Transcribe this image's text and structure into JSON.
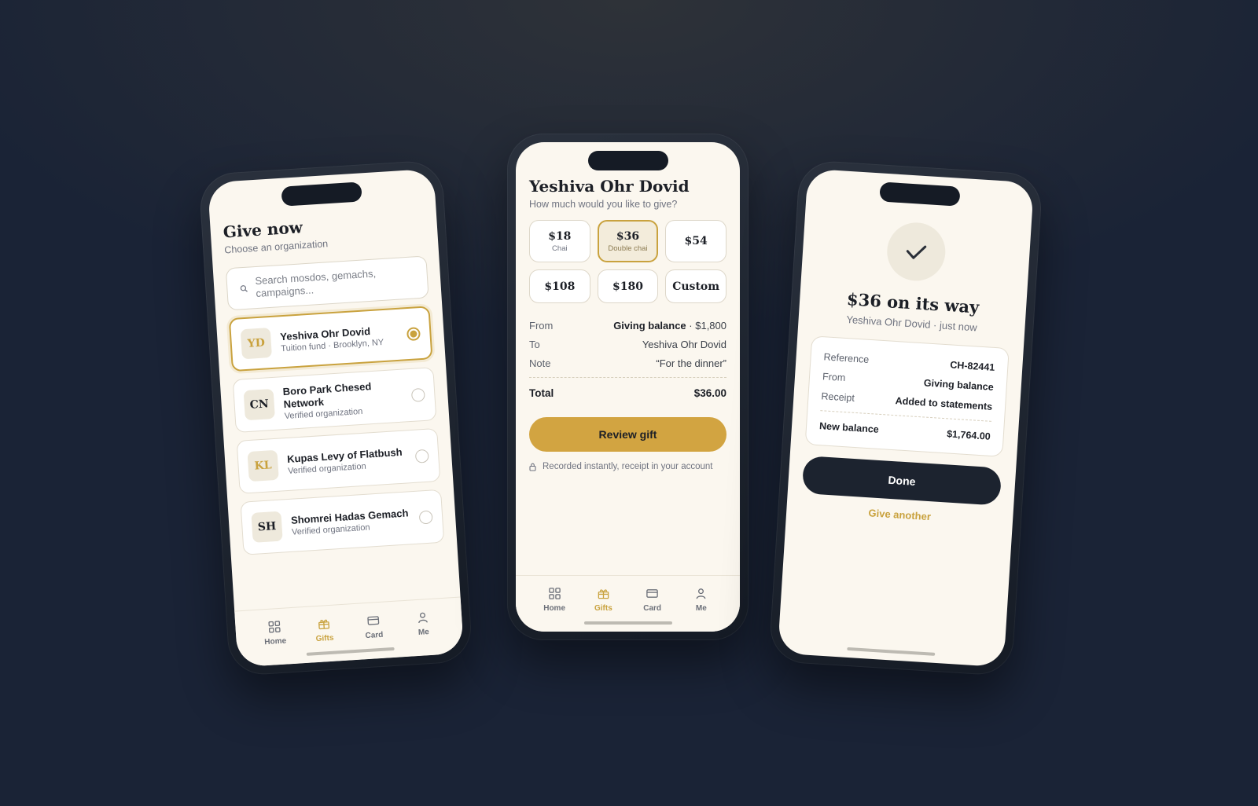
{
  "colors": {
    "accent": "#c9a23e",
    "screen_bg": "#fbf7ef",
    "dark": "#1c232f"
  },
  "tabs": [
    {
      "label": "Home",
      "icon": "grid-icon"
    },
    {
      "label": "Gifts",
      "icon": "gift-icon"
    },
    {
      "label": "Card",
      "icon": "card-icon"
    },
    {
      "label": "Me",
      "icon": "person-icon"
    }
  ],
  "active_tab": "Gifts",
  "choose": {
    "title": "Give now",
    "subtitle": "Choose an organization",
    "search_placeholder": "Search mosdos, gemachs, campaigns...",
    "orgs": [
      {
        "initials": "YD",
        "name": "Yeshiva Ohr Dovid",
        "meta": "Tuition fund · Brooklyn, NY",
        "selected": true
      },
      {
        "initials": "CN",
        "name": "Boro Park Chesed Network",
        "meta": "Verified organization",
        "selected": false
      },
      {
        "initials": "KL",
        "name": "Kupas Levy of Flatbush",
        "meta": "Verified organization",
        "selected": false
      },
      {
        "initials": "SH",
        "name": "Shomrei Hadas Gemach",
        "meta": "Verified organization",
        "selected": false
      }
    ]
  },
  "amount": {
    "title": "Yeshiva Ohr Dovid",
    "subtitle": "How much would you like to give?",
    "options": [
      {
        "value": "$18",
        "sub": "Chai"
      },
      {
        "value": "$36",
        "sub": "Double chai"
      },
      {
        "value": "$54"
      },
      {
        "value": "$108"
      },
      {
        "value": "$180"
      },
      {
        "value": "Custom"
      }
    ],
    "selected": "$36",
    "from_label": "From",
    "from_source": "Giving balance",
    "from_amount": "· $1,800",
    "to_label": "To",
    "to_value": "Yeshiva Ohr Dovid",
    "note_label": "Note",
    "note_value": "“For the dinner”",
    "total_label": "Total",
    "total_value": "$36.00",
    "review_button": "Review gift",
    "footnote": "Recorded instantly, receipt in your account"
  },
  "success": {
    "title": "$36 on its way",
    "subtitle": "Yeshiva Ohr Dovid · just now",
    "reference_label": "Reference",
    "reference_value": "CH-82441",
    "from_label": "From",
    "from_value": "Giving balance",
    "receipt_label": "Receipt",
    "receipt_value": "Added to statements",
    "balance_label": "New balance",
    "balance_value": "$1,764.00",
    "done_button": "Done",
    "another_link": "Give another"
  }
}
